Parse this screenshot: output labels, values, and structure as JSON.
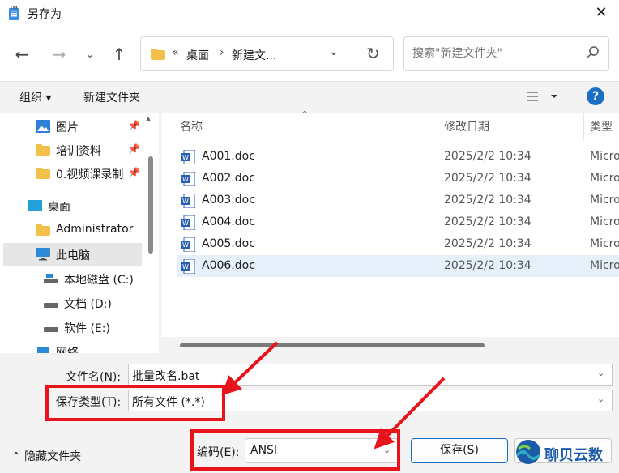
{
  "window": {
    "title": "另存为",
    "close_glyph": "✕"
  },
  "nav": {
    "back_glyph": "←",
    "forward_glyph": "→",
    "recent_glyph": "⌄",
    "up_glyph": "↑",
    "address": {
      "more_glyph": "«",
      "crumb1": "桌面",
      "separator": "›",
      "crumb2": "新建文...",
      "dropdown_glyph": "⌄",
      "refresh_glyph": "↻"
    },
    "search": {
      "placeholder": "搜索\"新建文件夹\""
    }
  },
  "toolbar": {
    "organize_label": "组织 ▾",
    "new_folder_label": "新建文件夹",
    "help_label": "?"
  },
  "sidebar": {
    "items": [
      {
        "label": "图片",
        "icon": "pictures-icon",
        "pinned": true
      },
      {
        "label": "培训资料",
        "icon": "folder-icon",
        "pinned": true
      },
      {
        "label": "0.视频课录制",
        "icon": "folder-icon",
        "pinned": true
      },
      {
        "label": "桌面",
        "icon": "desktop-icon",
        "pinned": false
      },
      {
        "label": "Administrator",
        "icon": "folder-icon",
        "pinned": false
      },
      {
        "label": "此电脑",
        "icon": "computer-icon",
        "pinned": false,
        "selected": true
      },
      {
        "label": "本地磁盘 (C:)",
        "icon": "drive-icon",
        "pinned": false
      },
      {
        "label": "文档 (D:)",
        "icon": "drive-icon",
        "pinned": false
      },
      {
        "label": "软件 (E:)",
        "icon": "drive-icon",
        "pinned": false
      },
      {
        "label": "网络",
        "icon": "network-icon",
        "pinned": false
      }
    ],
    "pin_glyph": "📌"
  },
  "filelist": {
    "columns": {
      "name": "名称",
      "modified": "修改日期",
      "type": "类型"
    },
    "sort_glyph": "^",
    "rows": [
      {
        "name": "A001.doc",
        "modified": "2025/2/2 10:34",
        "type": "Micro"
      },
      {
        "name": "A002.doc",
        "modified": "2025/2/2 10:34",
        "type": "Micro"
      },
      {
        "name": "A003.doc",
        "modified": "2025/2/2 10:34",
        "type": "Micro"
      },
      {
        "name": "A004.doc",
        "modified": "2025/2/2 10:34",
        "type": "Micro"
      },
      {
        "name": "A005.doc",
        "modified": "2025/2/2 10:34",
        "type": "Micro"
      },
      {
        "name": "A006.doc",
        "modified": "2025/2/2 10:34",
        "type": "Micro",
        "selected": true
      }
    ]
  },
  "form": {
    "filename_label": "文件名(N):",
    "filename_value": "批量改名.bat",
    "filetype_label": "保存类型(T):",
    "filetype_value": "所有文件 (*.*)",
    "hide_folders_label": "⌃ 隐藏文件夹",
    "encoding_label": "编码(E):",
    "encoding_value": "ANSI",
    "save_label": "保存(S)",
    "dropdown_glyph": "⌄"
  },
  "watermark": {
    "text": "聊贝云数"
  },
  "colors": {
    "accent": "#1a6fc4",
    "annotation": "#e8141b",
    "selected_row": "#e5f0fb"
  }
}
